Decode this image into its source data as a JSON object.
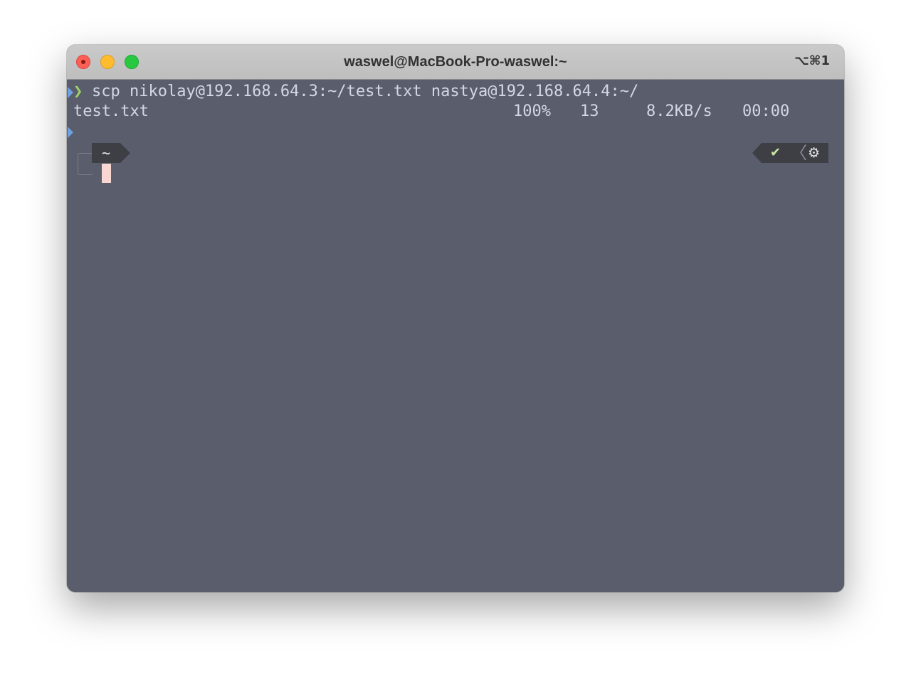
{
  "window": {
    "title": "waswel@MacBook-Pro-waswel:~",
    "shortcut": "⌥⌘1"
  },
  "terminal": {
    "command": "scp nikolay@192.168.64.3:~/test.txt nastya@192.168.64.4:~/",
    "prompt_chevron": "❯",
    "transfer": {
      "filename": "test.txt",
      "percent": "100%",
      "size": "13",
      "speed": "8.2KB/s",
      "eta": "00:00"
    },
    "dir_segment": "~",
    "status": {
      "check": "✔",
      "separator": "〈",
      "gear": "⚙"
    }
  },
  "colors": {
    "background": "#595d6c",
    "text": "#d4d8e6",
    "prompt_green": "#9fd16a",
    "prompt_blue": "#6fa0e0",
    "cursor": "#f8d6d2",
    "segment_bg": "#3d3f45"
  }
}
